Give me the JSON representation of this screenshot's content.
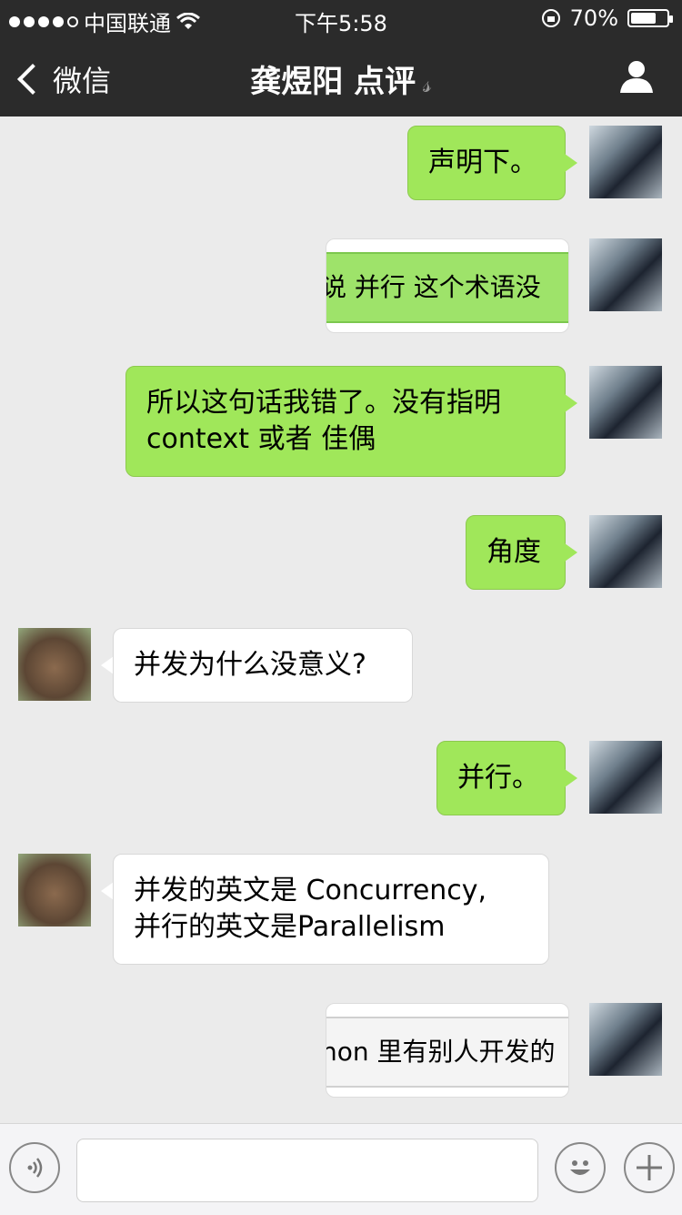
{
  "status_bar": {
    "carrier": "中国联通",
    "time": "下午5:58",
    "battery_percent": "70%",
    "battery_level": 0.7
  },
  "nav": {
    "back_label": "微信",
    "title": "龚煜阳 点评",
    "ear_icon": "ear-icon",
    "profile_icon": "person-icon"
  },
  "messages": [
    {
      "from": "me",
      "type": "text",
      "text": "声明下。"
    },
    {
      "from": "me",
      "type": "image",
      "text": "说 并行 这个术语没"
    },
    {
      "from": "me",
      "type": "text",
      "line1": "所以这句话我错了。没有指明",
      "line2": "context 或者 佳偶"
    },
    {
      "from": "me",
      "type": "text",
      "text": "角度"
    },
    {
      "from": "other",
      "type": "text",
      "text": "并发为什么没意义?"
    },
    {
      "from": "me",
      "type": "text",
      "text": "并行。"
    },
    {
      "from": "other",
      "type": "text",
      "line1": "并发的英文是 Concurrency,",
      "line2": "并行的英文是Parallelism"
    },
    {
      "from": "me",
      "type": "image",
      "text": "non 里有别人开发的"
    }
  ],
  "input_bar": {
    "voice_icon": "voice-icon",
    "emoji_icon": "emoji-icon",
    "plus_icon": "plus-icon"
  },
  "colors": {
    "nav_bg": "#2b2b2b",
    "chat_bg": "#ebebeb",
    "bubble_me": "#a0e75a",
    "bubble_other": "#ffffff"
  }
}
